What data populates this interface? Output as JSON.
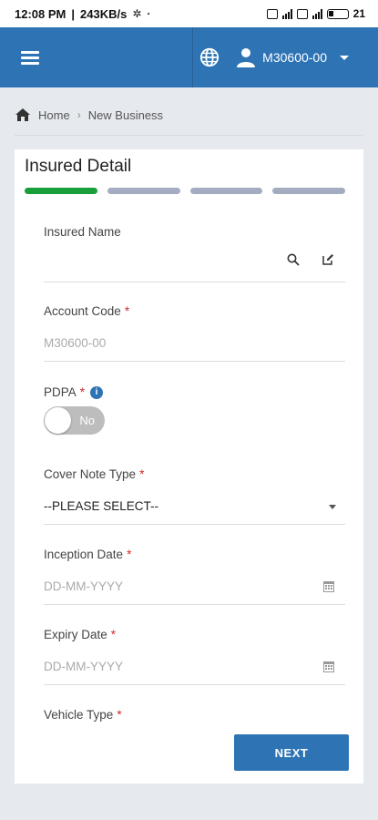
{
  "status_bar": {
    "time": "12:08 PM",
    "speed": "243KB/s",
    "battery": "21"
  },
  "header": {
    "menu_icon": "hamburger-icon",
    "language_icon": "globe-icon",
    "user_icon": "user-icon",
    "username": "M30600-00"
  },
  "breadcrumb": {
    "home_icon": "home-icon",
    "items": [
      "Home",
      "New Business"
    ]
  },
  "form": {
    "title": "Insured Detail",
    "steps_total": 4,
    "current_step": 1,
    "colors": {
      "step_active": "#1a9e3a",
      "step_inactive": "#a4acc2",
      "primary": "#2e74b5",
      "required": "#d02a2a"
    },
    "insured_name": {
      "label": "Insured Name",
      "value": ""
    },
    "account_code": {
      "label": "Account Code",
      "required": "*",
      "value": "M30600-00"
    },
    "pdpa": {
      "label": "PDPA",
      "required": "*",
      "toggle_text": "No",
      "info_icon": "info-icon"
    },
    "cover_note_type": {
      "label": "Cover Note Type",
      "required": "*",
      "selected": "--PLEASE SELECT--"
    },
    "inception_date": {
      "label": "Inception Date",
      "required": "*",
      "placeholder": "DD-MM-YYYY"
    },
    "expiry_date": {
      "label": "Expiry Date",
      "required": "*",
      "placeholder": "DD-MM-YYYY"
    },
    "vehicle_type": {
      "label": "Vehicle Type",
      "required": "*"
    },
    "next_label": "NEXT"
  }
}
